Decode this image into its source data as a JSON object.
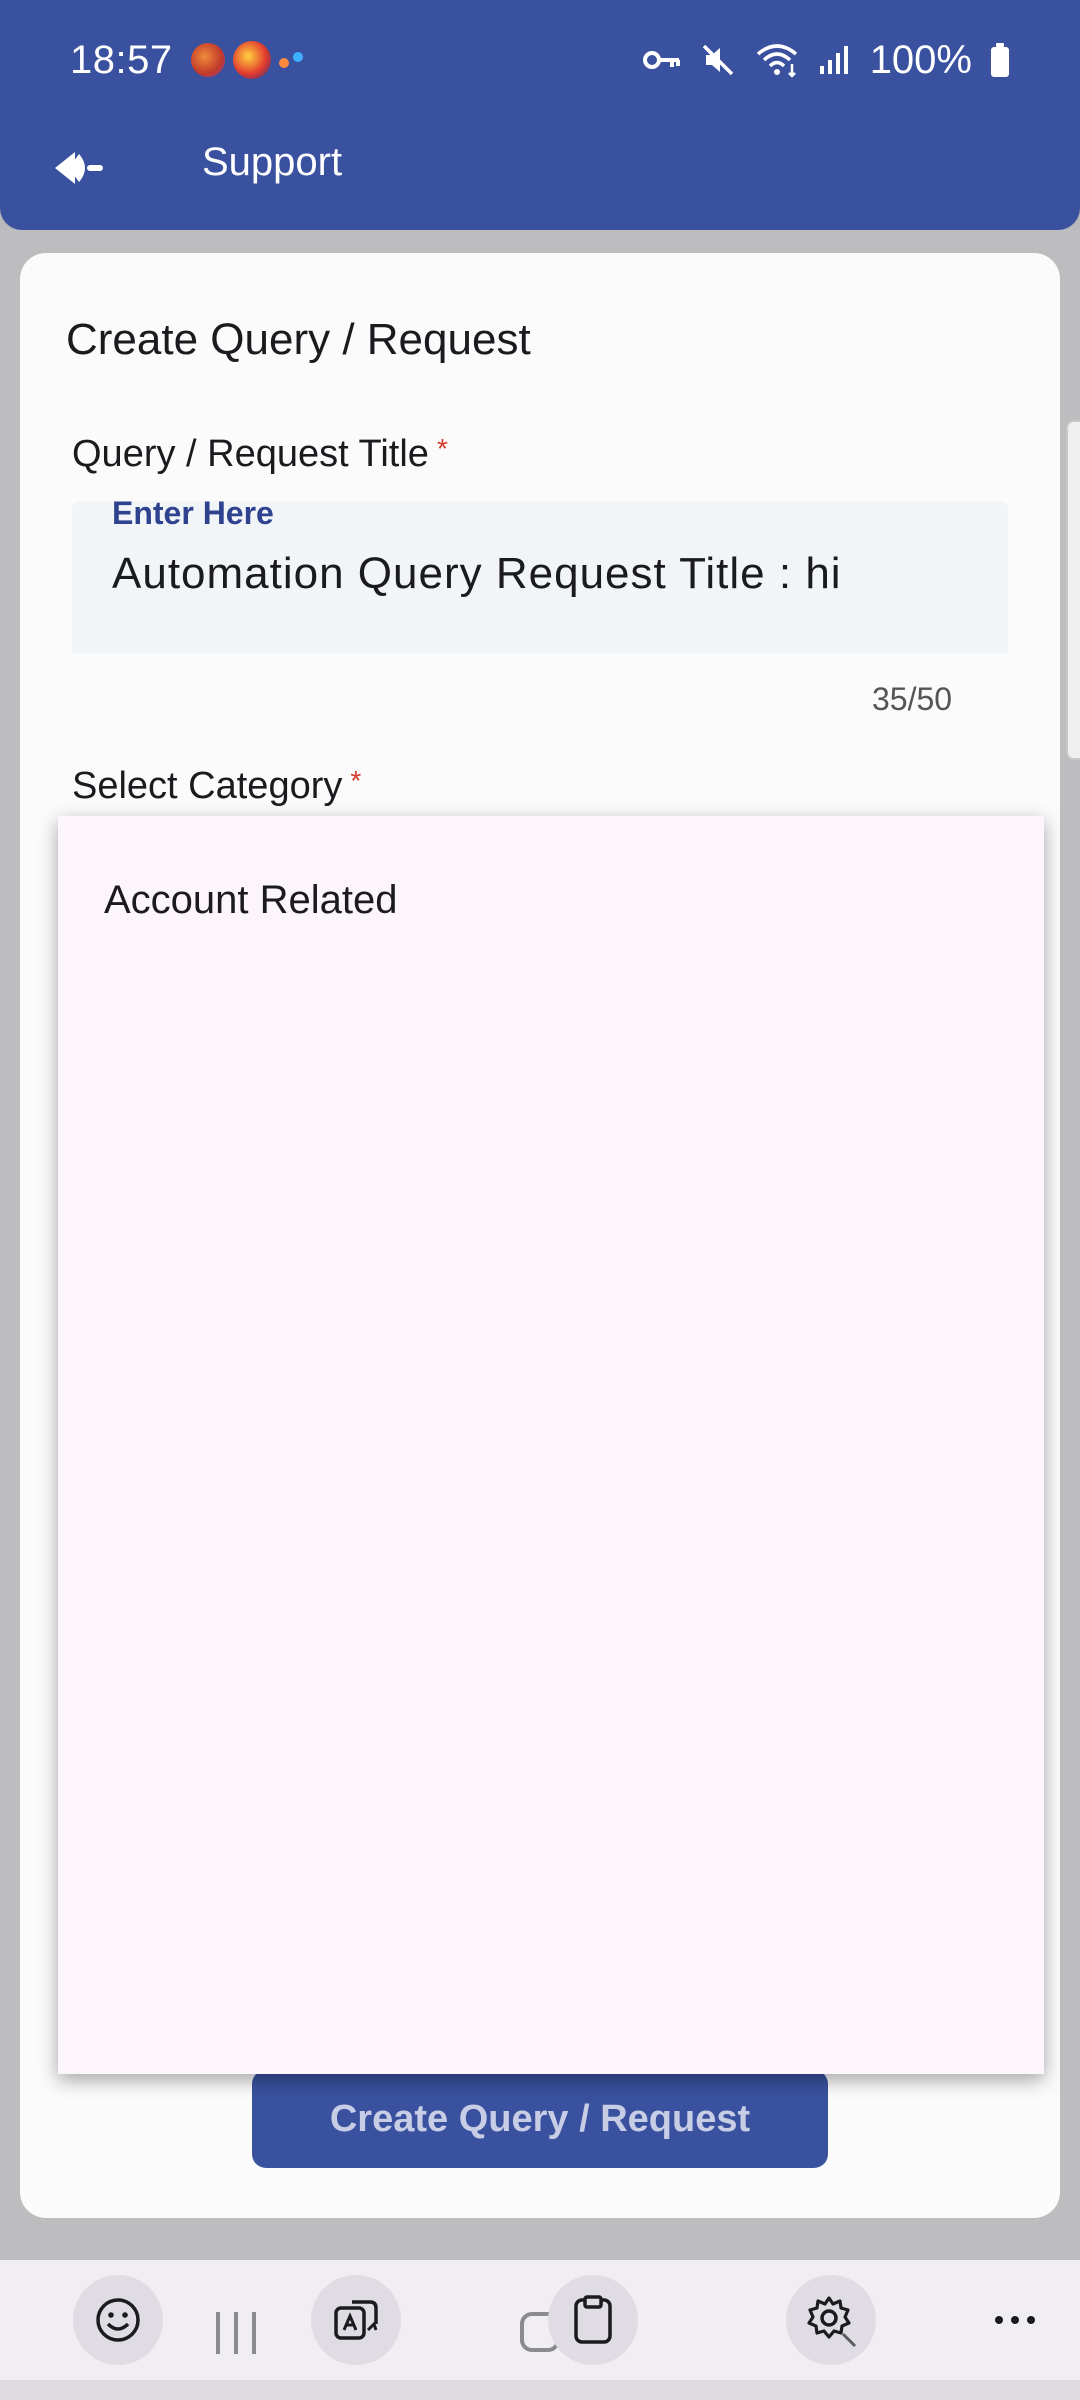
{
  "status_bar": {
    "time": "18:57",
    "battery": "100%"
  },
  "app_bar": {
    "title": "Support"
  },
  "form": {
    "heading": "Create Query / Request",
    "title_field": {
      "label": "Query / Request Title",
      "required_mark": "*",
      "floating_label": "Enter Here",
      "value": "Automation Query Request Title : hi",
      "counter": "35/50"
    },
    "category_field": {
      "label": "Select Category",
      "required_mark": "*"
    },
    "submit_label": "Create Query / Request"
  },
  "dropdown": {
    "options": [
      "Account Related"
    ]
  },
  "colors": {
    "brand": "#3a51a0",
    "required": "#d23a2a",
    "floating_label": "#2e428f"
  },
  "keyboard_toolbar": {
    "icons": [
      "emoji-icon",
      "translate-icon",
      "clipboard-icon",
      "settings-icon",
      "more-icon"
    ]
  }
}
